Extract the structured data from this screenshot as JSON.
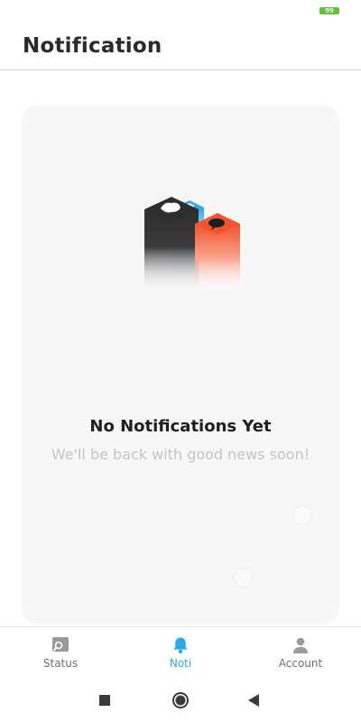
{
  "status_bar": {
    "battery_level": "99",
    "battery_color": "#5cc73b"
  },
  "header": {
    "title": "Notification"
  },
  "empty_state": {
    "title": "No Notifications Yet",
    "subtitle": "We'll be back with good news soon!",
    "illustration_icon": "notification-boxes-illustration",
    "colors": {
      "black_box": "#2e2e2e",
      "blue_box": "#2aa8e8",
      "orange_box": "#f2542d"
    }
  },
  "bottom_nav": {
    "items": [
      {
        "label": "Status",
        "icon": "status-icon",
        "active": false
      },
      {
        "label": "Noti",
        "icon": "bell-icon",
        "active": true
      },
      {
        "label": "Account",
        "icon": "account-icon",
        "active": false
      }
    ],
    "active_color": "#2aa8e8",
    "inactive_color": "#9a9a9a"
  },
  "system_nav": {
    "buttons": [
      "recents-icon",
      "home-icon",
      "back-icon"
    ]
  }
}
